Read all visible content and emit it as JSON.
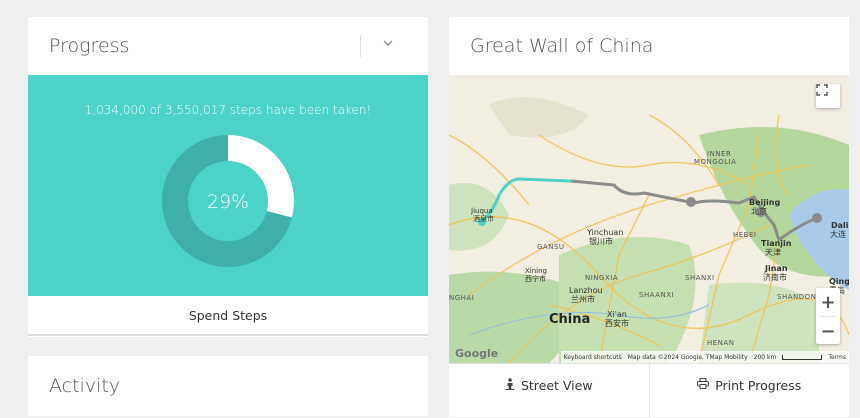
{
  "progress": {
    "title": "Progress",
    "steps_text": "1,034,000 of 3,550,017 steps have been taken!",
    "percent_label": "29%",
    "percent_value": 0.29,
    "spend_label": "Spend Steps",
    "colors": {
      "panel": "#4bd3c8",
      "ring_bg": "#3fb0a8",
      "ring_fill": "#ffffff"
    }
  },
  "activity": {
    "title": "Activity"
  },
  "map": {
    "title": "Great Wall of China",
    "labels": {
      "inner_mongolia_1": "INNER",
      "inner_mongolia_2": "MONGOLIA",
      "beijing": "Beijing",
      "beijing_cn": "北京",
      "hebei": "HEBEI",
      "tianjin": "Tianjin",
      "tianjin_cn": "天津",
      "dalian": "Dali",
      "dalian_cn": "大连",
      "jiuquan": "Jiuqua",
      "jiuquan_cn": "酒泉市",
      "gansu": "GANSU",
      "yinchuan": "Yinchuan",
      "yinchuan_cn": "银川市",
      "xining": "Xining",
      "xining_cn": "西宁市",
      "ningxia": "NINGXIA",
      "lanzhou": "Lanzhou",
      "lanzhou_cn": "兰州市",
      "shanxi": "SHANXI",
      "shaanxi": "SHAANXI",
      "jinan": "Jinan",
      "jinan_cn": "济南市",
      "qing": "Qing",
      "qing_cn": "青岛",
      "shandong": "SHANDON",
      "ghai": "NGHAI",
      "china": "China",
      "xian": "Xi'an",
      "xian_cn": "西安市",
      "henan": "HENAN"
    },
    "attribution": {
      "shortcuts": "Keyboard shortcuts",
      "data": "Map data ©2024 Google, TMap Mobility",
      "scale": "200 km",
      "terms": "Terms"
    },
    "google": "Google",
    "zoom_in": "+",
    "zoom_out": "−",
    "street_view_label": "Street View",
    "print_label": "Print Progress"
  }
}
